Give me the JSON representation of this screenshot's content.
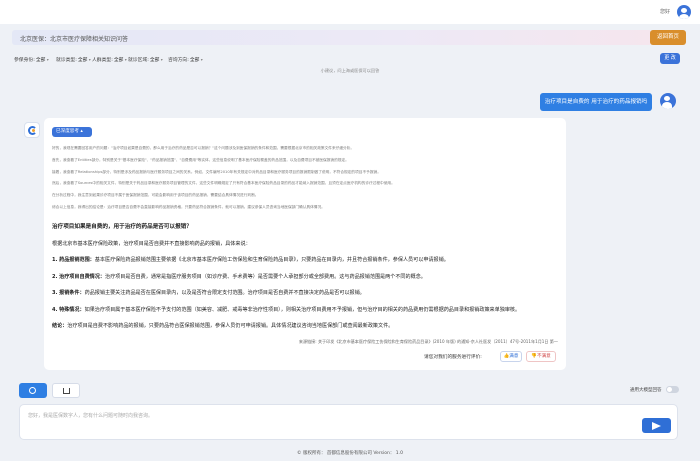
{
  "header": {
    "greeting": "您好"
  },
  "banner": {
    "text": "北京医保：北京市医疗保障相关知识问答",
    "home_button": "返回首页"
  },
  "filters": [
    {
      "label": "参保身份:",
      "value": "全部"
    },
    {
      "label": "就诊类型:",
      "value": "全部"
    },
    {
      "label": "人群类型:",
      "value": "全部"
    },
    {
      "label": "就诊区域:",
      "value": "全部"
    },
    {
      "label": "咨询方向:",
      "value": "全部"
    }
  ],
  "filter_button": "更 改",
  "tip": "小建议，问上海或医保可以回答",
  "user_message": "治疗项目是自费的 用于治疗的药品报销吗",
  "reply": {
    "think_label": "已深度思考",
    "thinking": [
      "好的，我现在需要回答用户的问题：\"治疗项目如果是自费的，那么用于治疗的药品是否可以报销？\"这个问题涉及到医保报销的条件和范围，需要根据北京市的相关政策文件来仔细分析。",
      "首先，我查看了Entities部分，特别是关于\"基本医疗保险\"、\"药品报销范围\"、\"自费费用\"等实体，这些信息说明了基本医疗保险覆盖的药品范围，以及自费项目不被医保报销的规定。",
      "接着，我查看了Relationships部分，特别是涉及药品报销与医疗服务项目之间的关系。例如，文件编号2010年有关规定中对药品目录和医疗服务项目的报销限制做了说明，不符合规定的项目不予报销。",
      "然后，我查看了Sources中的相关文件，特别是关于药品目录和医疗服务项目管理的文件，这些文件明确规定了只有符合基本医疗保险药品目录的药品才能纳入报销范围，且须在定点医疗机构的诊疗过程中使用。",
      "在分析过程中，我注意到如果诊疗项目不属于医保报销范围，可能会影响用于该项目的药品报销，需要结合具体情况进行判断。",
      "综合以上信息，我得出的结论是：治疗项目是否自费不会直接影响药品报销资格，只要药品符合报销条件，就可以报销。建议参保人员咨询当地医保部门确认具体情况。"
    ],
    "answer_title": "治疗项目如果是自费的，用于治疗的药品是否可以报销？",
    "answer_intro": "根据北京市基本医疗保险政策，治疗项目是否自费并不直接影响药品的报销，具体来说：",
    "points": [
      {
        "n": "1.",
        "title": "药品报销范围：",
        "text": "基本医疗保险药品报销范围主要依据《北京市基本医疗保险工伤保险和生育保险药品目录》，只要药品在目录内，并且符合报销条件，参保人员可以申请报销。"
      },
      {
        "n": "2.",
        "title": "治疗项目自费情况：",
        "text": "治疗项目是否自费，通常是指医疗服务项目（如诊疗费、手术费等）是否需要个人承担部分或全部费用。这与药品报销范围是两个不同的概念。"
      },
      {
        "n": "3.",
        "title": "报销条件：",
        "text": "药品报销主要关注药品是否在医保目录内，以及是否符合限定支付范围。治疗项目是否自费并不直接决定药品是否可以报销。"
      },
      {
        "n": "4.",
        "title": "特殊情况：",
        "text": "如果治疗项目属于基本医疗保险不予支付的范围（如美容、减肥、戒毒等非治疗性项目），则相关治疗项目费用不予报销，但与治疗目的相关的药品费用仍需根据药品目录和报销政策来单独审核。"
      }
    ],
    "conclusion_label": "结论：",
    "conclusion": "治疗项目是自费不影响药品的报销，只要药品符合医保报销范围，参保人员仍可申请报销。具体情况建议咨询当地医保部门或查阅最新政策文件。",
    "source": "来源链接: 关于印发《北京市基本医疗保险工伤保险和生育保险药品目录》(2010 年版) 的通知-京人社医发〔2011〕47号-2011年1月1日 第一",
    "feedback_question": "请您对我们的服务进行评价:",
    "feedback_yes": "满意",
    "feedback_no": "不满意"
  },
  "toggle_label": "通用大模型回答",
  "input_placeholder": "您好，我是医保数字人，您有什么问题可随时向我咨询。",
  "footer": "© 版权所有：  首都信息股份有限公司 Version： 1.0"
}
